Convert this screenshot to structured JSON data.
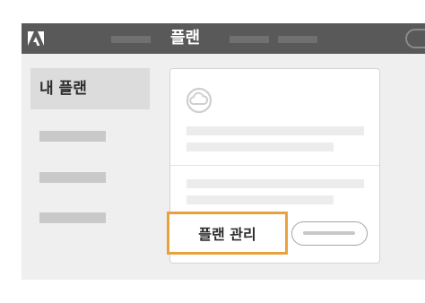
{
  "window": {
    "title": "플랜"
  },
  "sidebar": {
    "items": [
      {
        "label": "내 플랜",
        "selected": true
      }
    ]
  },
  "plan_card": {
    "icon": "creative-cloud-icon",
    "manage_button_label": "플랜 관리"
  },
  "colors": {
    "titlebar": "#595959",
    "highlight": "#e9a23b",
    "sidebar_selected": "#dcdcdc"
  }
}
